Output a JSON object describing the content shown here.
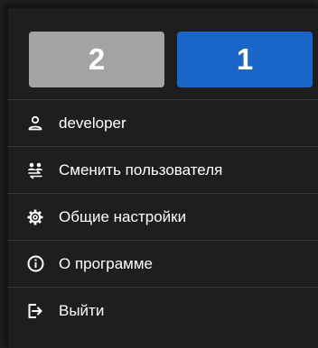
{
  "selector": {
    "options": [
      {
        "label": "2",
        "active": false
      },
      {
        "label": "1",
        "active": true
      }
    ]
  },
  "menu": {
    "items": [
      {
        "label": "developer",
        "icon": "user-icon"
      },
      {
        "label": "Сменить пользователя",
        "icon": "switch-user-icon"
      },
      {
        "label": "Общие настройки",
        "icon": "gear-icon"
      },
      {
        "label": "О программе",
        "icon": "info-icon"
      },
      {
        "label": "Выйти",
        "icon": "logout-icon"
      }
    ]
  },
  "colors": {
    "background": "#1e1e1e",
    "active_segment": "#1a66c8",
    "inactive_segment": "#a3a3a3",
    "divider": "#3a3a3a",
    "text": "#ffffff"
  }
}
